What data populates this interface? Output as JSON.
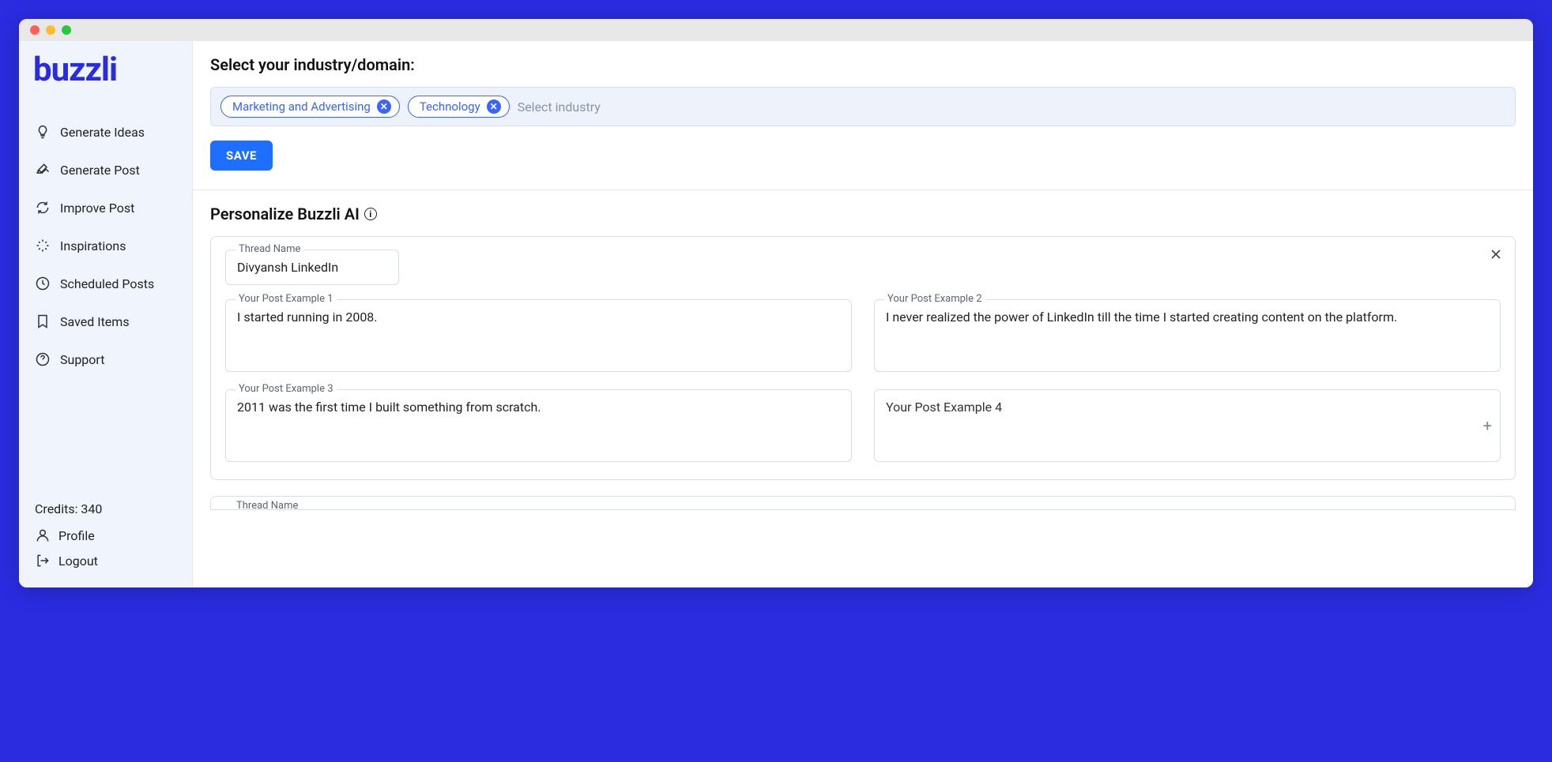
{
  "brand": "buzzli",
  "sidebar": {
    "items": [
      {
        "label": "Generate Ideas"
      },
      {
        "label": "Generate Post"
      },
      {
        "label": "Improve Post"
      },
      {
        "label": "Inspirations"
      },
      {
        "label": "Scheduled Posts"
      },
      {
        "label": "Saved Items"
      },
      {
        "label": "Support"
      }
    ],
    "credits_label": "Credits: 340",
    "profile_label": "Profile",
    "logout_label": "Logout"
  },
  "industry": {
    "heading": "Select your industry/domain:",
    "tags": [
      {
        "label": "Marketing and Advertising"
      },
      {
        "label": "Technology"
      }
    ],
    "placeholder": "Select industry",
    "save_label": "SAVE"
  },
  "personalize": {
    "heading": "Personalize Buzzli AI",
    "thread_name_label": "Thread Name",
    "thread_name_value": "Divyansh LinkedIn",
    "examples": [
      {
        "label": "Your Post Example 1",
        "value": "I started running in 2008."
      },
      {
        "label": "Your Post Example 2",
        "value": "I never realized the power of LinkedIn till the time I started creating content on the platform."
      },
      {
        "label": "Your Post Example 3",
        "value": "2011 was the first time I built something from scratch."
      },
      {
        "label": "Your Post Example 4",
        "value": ""
      }
    ],
    "peek_label": "Thread Name"
  }
}
